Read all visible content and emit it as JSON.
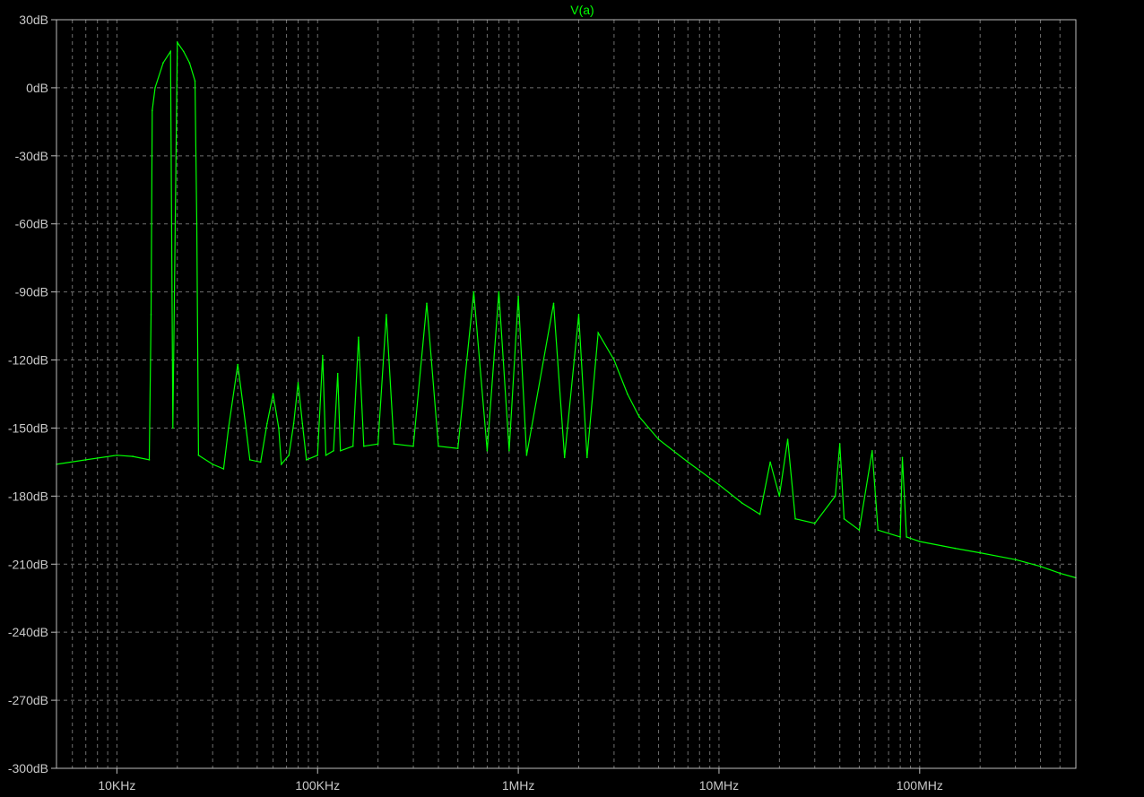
{
  "chart_data": {
    "type": "line",
    "title": "V(a)",
    "xlabel": "",
    "ylabel": "",
    "x_scale": "log",
    "xlim": [
      5000,
      600000000
    ],
    "ylim": [
      -300,
      30
    ],
    "grid": true,
    "background": "#000000",
    "grid_color": "#707070",
    "series_color": "#00ff00",
    "x_ticks": [
      {
        "value": 10000,
        "label": "10KHz"
      },
      {
        "value": 100000,
        "label": "100KHz"
      },
      {
        "value": 1000000,
        "label": "1MHz"
      },
      {
        "value": 10000000,
        "label": "10MHz"
      },
      {
        "value": 100000000,
        "label": "100MHz"
      }
    ],
    "y_ticks": [
      {
        "value": 30,
        "label": "30dB"
      },
      {
        "value": 0,
        "label": "0dB"
      },
      {
        "value": -30,
        "label": "-30dB"
      },
      {
        "value": -60,
        "label": "-60dB"
      },
      {
        "value": -90,
        "label": "-90dB"
      },
      {
        "value": -120,
        "label": "-120dB"
      },
      {
        "value": -150,
        "label": "-150dB"
      },
      {
        "value": -180,
        "label": "-180dB"
      },
      {
        "value": -210,
        "label": "-210dB"
      },
      {
        "value": -240,
        "label": "-240dB"
      },
      {
        "value": -270,
        "label": "-270dB"
      },
      {
        "value": -300,
        "label": "-300dB"
      }
    ],
    "series": [
      {
        "points": [
          [
            5000,
            -166
          ],
          [
            7000,
            -164
          ],
          [
            10000,
            -162
          ],
          [
            12000,
            -162.5
          ],
          [
            14500,
            -164
          ],
          [
            14800,
            -100
          ],
          [
            15000,
            -10
          ],
          [
            15500,
            0
          ],
          [
            17000,
            11
          ],
          [
            18500,
            16
          ],
          [
            20000,
            20
          ],
          [
            21500,
            16
          ],
          [
            23000,
            11
          ],
          [
            24500,
            3
          ],
          [
            25000,
            -60
          ],
          [
            25500,
            -162
          ],
          [
            30000,
            -166
          ],
          [
            34000,
            -168
          ],
          [
            36000,
            -150
          ],
          [
            40000,
            -122
          ],
          [
            44000,
            -150
          ],
          [
            46000,
            -164
          ],
          [
            52000,
            -165
          ],
          [
            56000,
            -148
          ],
          [
            60000,
            -135
          ],
          [
            64000,
            -150
          ],
          [
            66000,
            -166
          ],
          [
            72000,
            -162
          ],
          [
            76000,
            -148
          ],
          [
            80000,
            -130
          ],
          [
            84000,
            -148
          ],
          [
            88000,
            -164
          ],
          [
            100000,
            -162
          ],
          [
            106000,
            -118
          ],
          [
            110000,
            -162
          ],
          [
            120000,
            -160
          ],
          [
            126000,
            -126
          ],
          [
            130000,
            -160
          ],
          [
            150000,
            -158
          ],
          [
            160000,
            -110
          ],
          [
            170000,
            -158
          ],
          [
            200000,
            -157
          ],
          [
            220000,
            -100
          ],
          [
            240000,
            -157
          ],
          [
            300000,
            -158
          ],
          [
            350000,
            -95
          ],
          [
            400000,
            -158
          ],
          [
            500000,
            -159
          ],
          [
            600000,
            -90
          ],
          [
            700000,
            -160
          ],
          [
            800000,
            -90
          ],
          [
            900000,
            -160
          ],
          [
            1000000,
            -92
          ],
          [
            1100000,
            -162
          ],
          [
            1500000,
            -95
          ],
          [
            1700000,
            -163
          ],
          [
            2000000,
            -100
          ],
          [
            2200000,
            -163
          ],
          [
            2500000,
            -108
          ],
          [
            3000000,
            -120
          ],
          [
            3500000,
            -135
          ],
          [
            4000000,
            -145
          ],
          [
            5000000,
            -155
          ],
          [
            7000000,
            -165
          ],
          [
            10000000,
            -175
          ],
          [
            13000000,
            -183
          ],
          [
            16000000,
            -188
          ],
          [
            18000000,
            -165
          ],
          [
            19000,
            -150
          ],
          [
            20000000,
            -180
          ],
          [
            22000000,
            -155
          ],
          [
            24000000,
            -190
          ],
          [
            30000000,
            -192
          ],
          [
            38000000,
            -180
          ],
          [
            40000000,
            -157
          ],
          [
            42000000,
            -190
          ],
          [
            50000000,
            -195
          ],
          [
            58000000,
            -160
          ],
          [
            62000000,
            -195
          ],
          [
            80000000,
            -198
          ],
          [
            82000000,
            -163
          ],
          [
            86000000,
            -198
          ],
          [
            100000000,
            -200
          ],
          [
            150000000,
            -203
          ],
          [
            200000000,
            -205
          ],
          [
            300000000,
            -208
          ],
          [
            400000000,
            -211
          ],
          [
            500000000,
            -214
          ],
          [
            600000000,
            -216
          ]
        ]
      }
    ]
  }
}
